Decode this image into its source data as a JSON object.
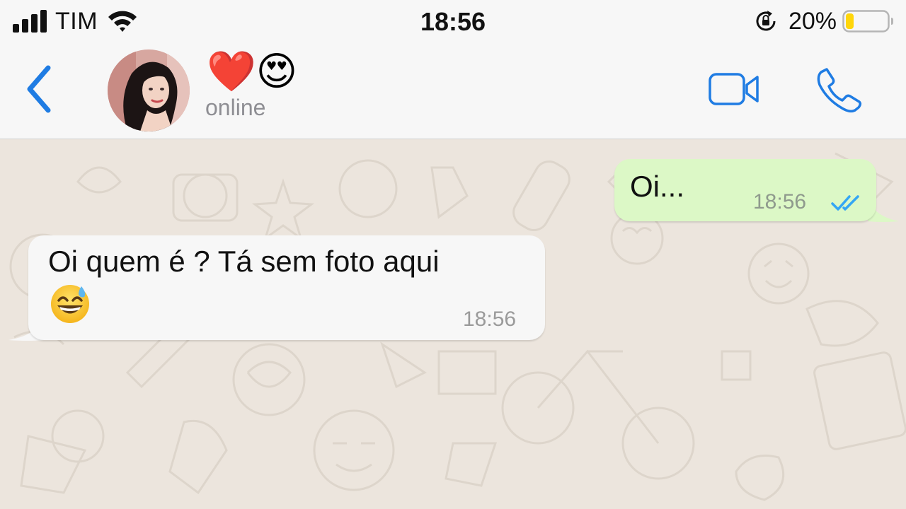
{
  "status_bar": {
    "carrier": "TIM",
    "time": "18:56",
    "battery_percent": "20%",
    "battery_level": 0.2,
    "icons": [
      "signal-icon",
      "wifi-icon",
      "rotation-lock-icon",
      "battery-icon"
    ]
  },
  "header": {
    "contact_name": "❤️😍",
    "contact_status": "online",
    "icons": [
      "back-chevron-icon",
      "video-camera-icon",
      "phone-icon"
    ]
  },
  "messages": [
    {
      "direction": "outgoing",
      "text": "Oi...",
      "time": "18:56",
      "status": "read"
    },
    {
      "direction": "incoming",
      "text": "Oi quem é ? Tá sem foto aqui",
      "emoji": "smiling-face-with-sweat-emoji",
      "time": "18:56"
    }
  ],
  "colors": {
    "accent": "#1f7ce3",
    "outgoing_bubble": "#dcf8c6",
    "incoming_bubble": "#f7f7f7",
    "chat_background": "#ece5dd",
    "read_ticks": "#34a6f4",
    "battery_low": "#ffd60a"
  }
}
